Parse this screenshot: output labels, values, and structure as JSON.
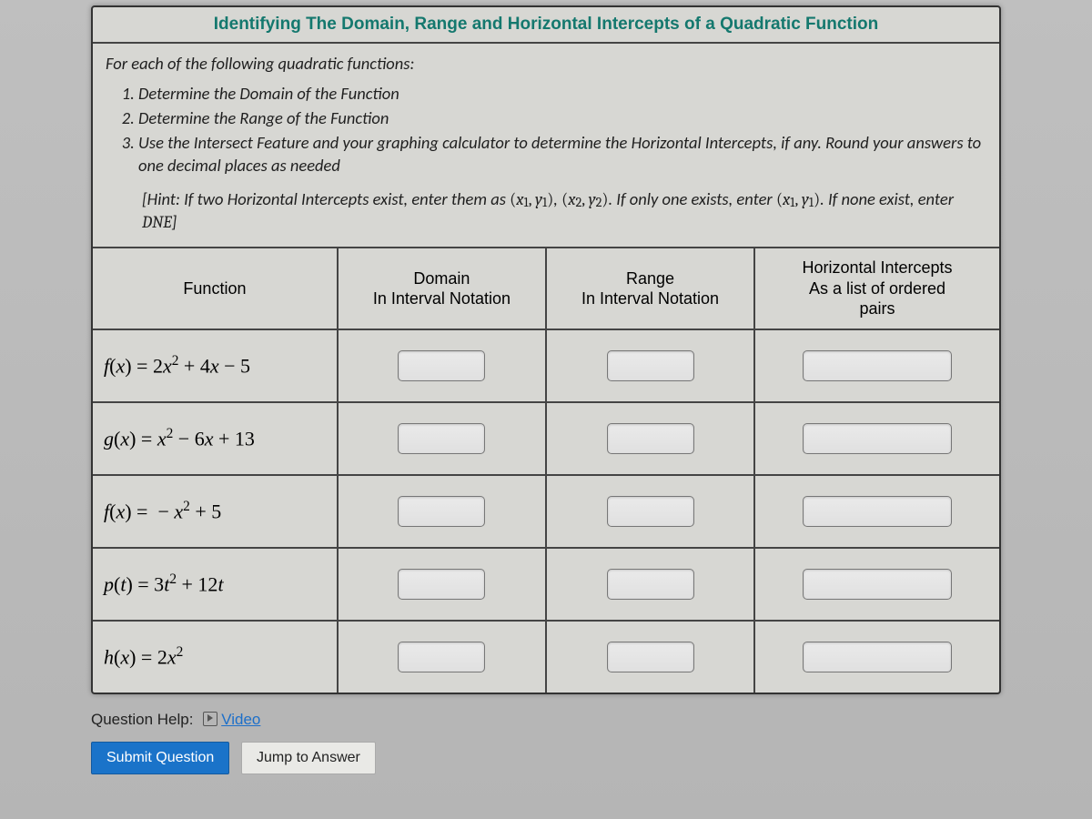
{
  "title": "Identifying The Domain, Range and Horizontal Intercepts of a Quadratic Function",
  "intro_lead": "For each of the following quadratic functions:",
  "instructions": [
    "Determine the Domain of the Function",
    "Determine the Range of the Function",
    "Use the Intersect Feature and your graphing calculator to determine the Horizontal Intercepts, if any. Round your answers to one decimal places as needed"
  ],
  "hint_prefix": "[Hint: If two Horizontal Intercepts exist, enter them as ",
  "hint_pair1": "(x₁, y₁)",
  "hint_mid": ", ",
  "hint_pair2": "(x₂, y₂)",
  "hint_after_pairs": ". If only one exists, enter ",
  "hint_pair3": "(x₁, y₁)",
  "hint_none": ". If none exist, enter ",
  "hint_dne": "DNE",
  "hint_suffix": "]",
  "headers": {
    "fn": "Function",
    "domain_l1": "Domain",
    "domain_l2": "In Interval Notation",
    "range_l1": "Range",
    "range_l2": "In Interval Notation",
    "int_l1": "Horizontal Intercepts",
    "int_l2": "As a list of ordered",
    "int_l3": "pairs"
  },
  "rows": [
    {
      "fn_html": "f(x) = 2x² + 4x − 5"
    },
    {
      "fn_html": "g(x) = x² − 6x + 13"
    },
    {
      "fn_html": "f(x) = − x² + 5"
    },
    {
      "fn_html": "p(t) = 3t² + 12t"
    },
    {
      "fn_html": "h(x) = 2x²"
    }
  ],
  "qhelp_label": "Question Help:",
  "video_label": "Video",
  "submit_label": "Submit Question",
  "jump_label": "Jump to Answer"
}
